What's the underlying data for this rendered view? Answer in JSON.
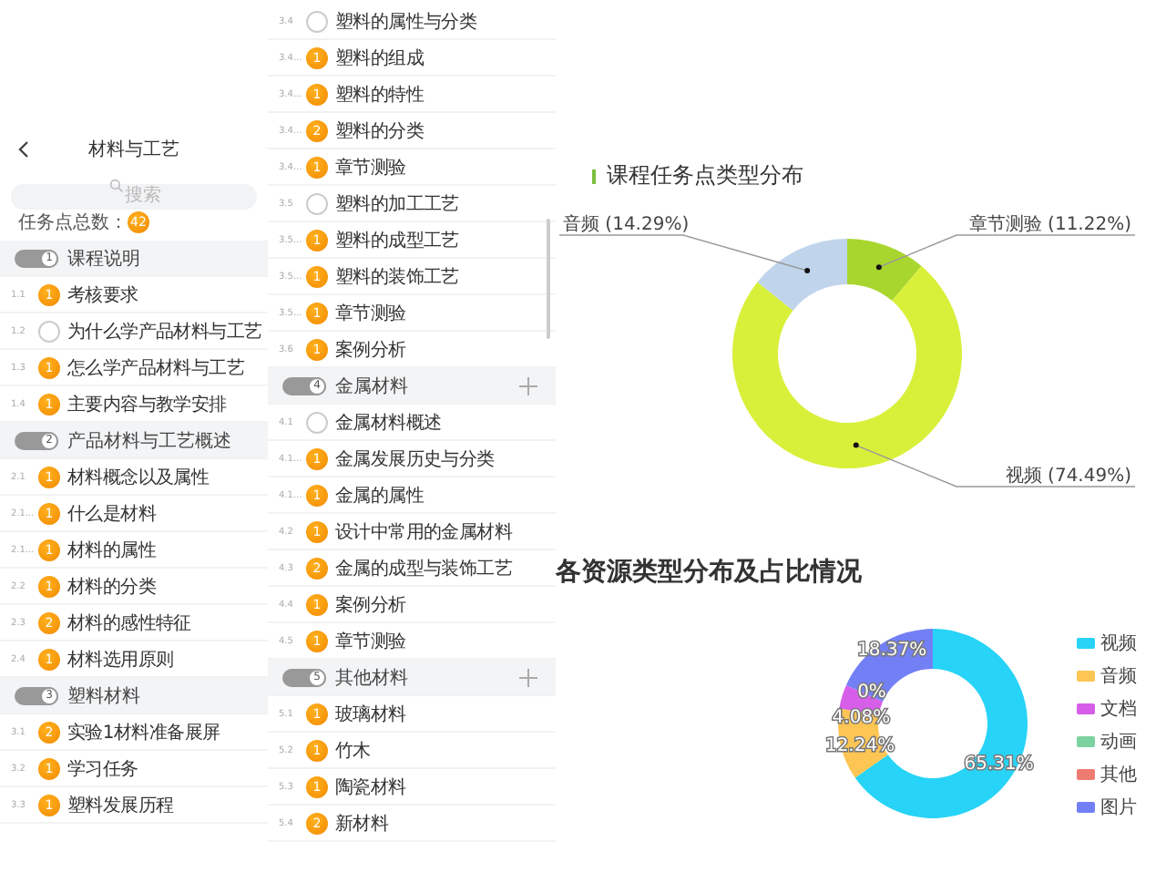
{
  "left": {
    "header": {
      "title": "材料与工艺"
    },
    "search": {
      "placeholder": "搜索"
    },
    "total": {
      "label": "任务点总数：",
      "count": "42"
    },
    "sections": [
      {
        "number": "1",
        "title": "课程说明",
        "children": [
          {
            "number": "1.1",
            "title": "考核要求",
            "badge": "1"
          },
          {
            "number": "1.2",
            "title": "为什么学产品材料与工艺"
          },
          {
            "number": "1.3",
            "title": "怎么学产品材料与工艺",
            "badge": "1"
          },
          {
            "number": "1.4",
            "title": "主要内容与教学安排",
            "badge": "1"
          }
        ]
      },
      {
        "number": "2",
        "title": "产品材料与工艺概述",
        "children": [
          {
            "number": "2.1",
            "title": "材料概念以及属性",
            "badge": "1"
          },
          {
            "number": "2.1...",
            "title": "什么是材料",
            "badge": "1"
          },
          {
            "number": "2.1...",
            "title": "材料的属性",
            "badge": "1"
          },
          {
            "number": "2.2",
            "title": "材料的分类",
            "badge": "1"
          },
          {
            "number": "2.3",
            "title": "材料的感性特征",
            "badge": "2"
          },
          {
            "number": "2.4",
            "title": "材料选用原则",
            "badge": "1"
          }
        ]
      },
      {
        "number": "3",
        "title": "塑料材料",
        "children": [
          {
            "number": "3.1",
            "title": "实验1材料准备展屏",
            "badge": "2"
          },
          {
            "number": "3.2",
            "title": "学习任务",
            "badge": "1"
          },
          {
            "number": "3.3",
            "title": "塑料发展历程",
            "badge": "1"
          }
        ]
      }
    ]
  },
  "middle": {
    "rows": [
      {
        "number": "3.4",
        "title": "塑料的属性与分类"
      },
      {
        "number": "3.4...",
        "title": "塑料的组成",
        "badge": "1"
      },
      {
        "number": "3.4...",
        "title": "塑料的特性",
        "badge": "1"
      },
      {
        "number": "3.4...",
        "title": "塑料的分类",
        "badge": "2"
      },
      {
        "number": "3.4...",
        "title": "章节测验",
        "badge": "1"
      },
      {
        "number": "3.5",
        "title": "塑料的加工工艺"
      },
      {
        "number": "3.5...",
        "title": "塑料的成型工艺",
        "badge": "1"
      },
      {
        "number": "3.5...",
        "title": "塑料的装饰工艺",
        "badge": "1"
      },
      {
        "number": "3.5...",
        "title": "章节测验",
        "badge": "1"
      },
      {
        "number": "3.6",
        "title": "案例分析",
        "badge": "1"
      }
    ],
    "sections": [
      {
        "number": "4",
        "title": "金属材料",
        "children": [
          {
            "number": "4.1",
            "title": "金属材料概述"
          },
          {
            "number": "4.1...",
            "title": "金属发展历史与分类",
            "badge": "1"
          },
          {
            "number": "4.1...",
            "title": "金属的属性",
            "badge": "1"
          },
          {
            "number": "4.2",
            "title": "设计中常用的金属材料",
            "badge": "1"
          },
          {
            "number": "4.3",
            "title": "金属的成型与装饰工艺",
            "badge": "2"
          },
          {
            "number": "4.4",
            "title": "案例分析",
            "badge": "1"
          },
          {
            "number": "4.5",
            "title": "章节测验",
            "badge": "1"
          }
        ]
      },
      {
        "number": "5",
        "title": "其他材料",
        "children": [
          {
            "number": "5.1",
            "title": "玻璃材料",
            "badge": "1"
          },
          {
            "number": "5.2",
            "title": "竹木",
            "badge": "1"
          },
          {
            "number": "5.3",
            "title": "陶瓷材料",
            "badge": "1"
          },
          {
            "number": "5.4",
            "title": "新材料",
            "badge": "2"
          }
        ]
      }
    ]
  },
  "chart1": {
    "chart_data": {
      "type": "donut",
      "title": "课程任务点类型分布",
      "categories": [
        "章节测验",
        "视频",
        "音频"
      ],
      "values": [
        11.22,
        74.49,
        14.29
      ],
      "value_labels": [
        "(11.22%)",
        "(74.49%)",
        "(14.29%)"
      ]
    },
    "slices": [
      {
        "color": "#a8d62e"
      },
      {
        "color": "#d8f03a"
      },
      {
        "color": "#c0d4ec"
      }
    ]
  },
  "chart2": {
    "chart_data": {
      "type": "donut",
      "title": "各资源类型分布及占比情况",
      "categories": [
        "视频",
        "音频",
        "文档",
        "动画",
        "其他",
        "图片"
      ],
      "values": [
        65.31,
        12.24,
        4.08,
        0,
        0,
        18.37
      ],
      "value_labels": [
        "65.31%",
        "12.24%",
        "4.08%",
        "0%",
        null,
        "18.37%"
      ]
    },
    "legend": [
      {
        "color": "#27d3f6"
      },
      {
        "color": "#fdc553"
      },
      {
        "color": "#d75ee9"
      },
      {
        "color": "#7dd3a0"
      },
      {
        "color": "#ee7b72"
      },
      {
        "color": "#7380f5"
      }
    ]
  }
}
